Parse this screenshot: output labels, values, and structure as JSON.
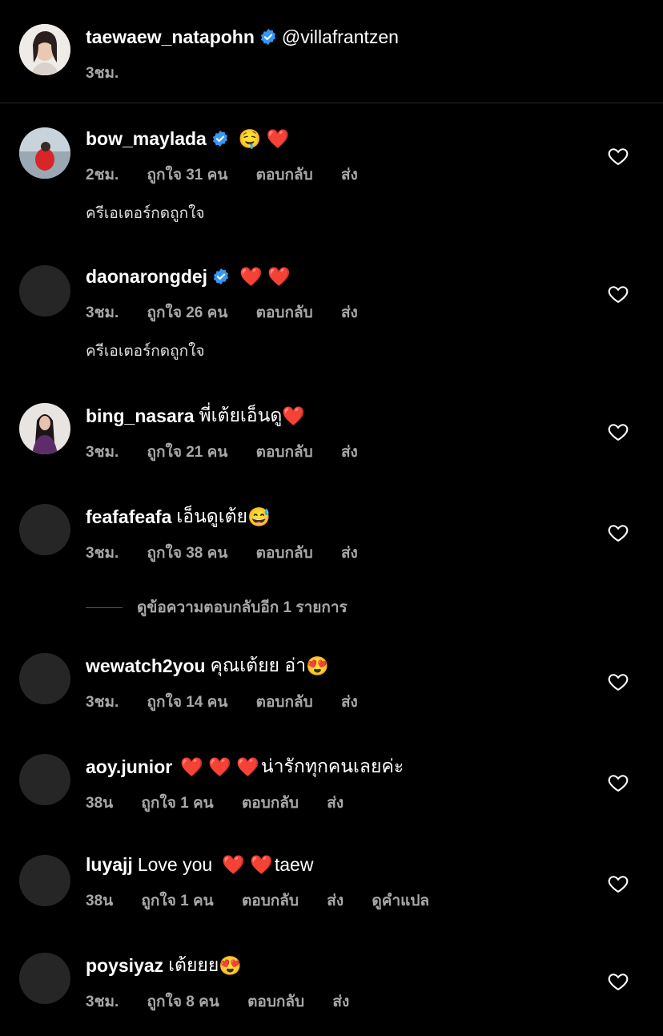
{
  "caption": {
    "username": "taewaew_natapohn",
    "mention": "@villafrantzen",
    "time": "3ชม."
  },
  "labels": {
    "reply": "ตอบกลับ",
    "send": "ส่ง",
    "creator_liked": "ครีเอเตอร์กดถูกใจ",
    "translate": "ดูคำแปล",
    "view_replies": "ดูข้อความตอบกลับอีก 1 รายการ"
  },
  "comments": [
    {
      "username": "bow_maylada",
      "text": "",
      "emoji": "🤤 ❤️",
      "verified": true,
      "time": "2ชม.",
      "likes": "ถูกใจ 31 คน",
      "creator_liked": true
    },
    {
      "username": "daonarongdej",
      "text": "",
      "emoji": "❤️ ❤️",
      "verified": true,
      "time": "3ชม.",
      "likes": "ถูกใจ 26 คน",
      "creator_liked": true
    },
    {
      "username": "bing_nasara",
      "text": "พี่เต้ยเอ็นดู",
      "emoji": "❤️",
      "verified": false,
      "time": "3ชม.",
      "likes": "ถูกใจ 21 คน"
    },
    {
      "username": "feafafeafa",
      "text": "เอ็นดูเต้ย",
      "emoji": "😅",
      "verified": false,
      "time": "3ชม.",
      "likes": "ถูกใจ 38 คน"
    },
    {
      "username": "wewatch2you",
      "text": "คุณเต้ยย อ่า",
      "emoji": "😍",
      "verified": false,
      "time": "3ชม.",
      "likes": "ถูกใจ 14 คน"
    },
    {
      "username": "aoy.junior",
      "text": "น่ารักทุกคนเลยค่ะ",
      "emoji": "❤️ ❤️ ❤️",
      "verified": false,
      "time": "38น",
      "likes": "ถูกใจ 1 คน"
    },
    {
      "username": "luyajj",
      "text": "Love you",
      "emoji": "❤️ ❤️",
      "text2": "taew",
      "verified": false,
      "time": "38น",
      "likes": "ถูกใจ 1 คน",
      "translate": true
    },
    {
      "username": "poysiyaz",
      "text": "เต้ยยย",
      "emoji": "😍",
      "verified": false,
      "time": "3ชม.",
      "likes": "ถูกใจ 8 คน"
    }
  ],
  "icons": {
    "verified": "verified-badge-icon",
    "like": "heart-outline-icon"
  },
  "colors": {
    "background": "#000000",
    "meta": "#a8a8a8",
    "verified": "#3897f0"
  }
}
